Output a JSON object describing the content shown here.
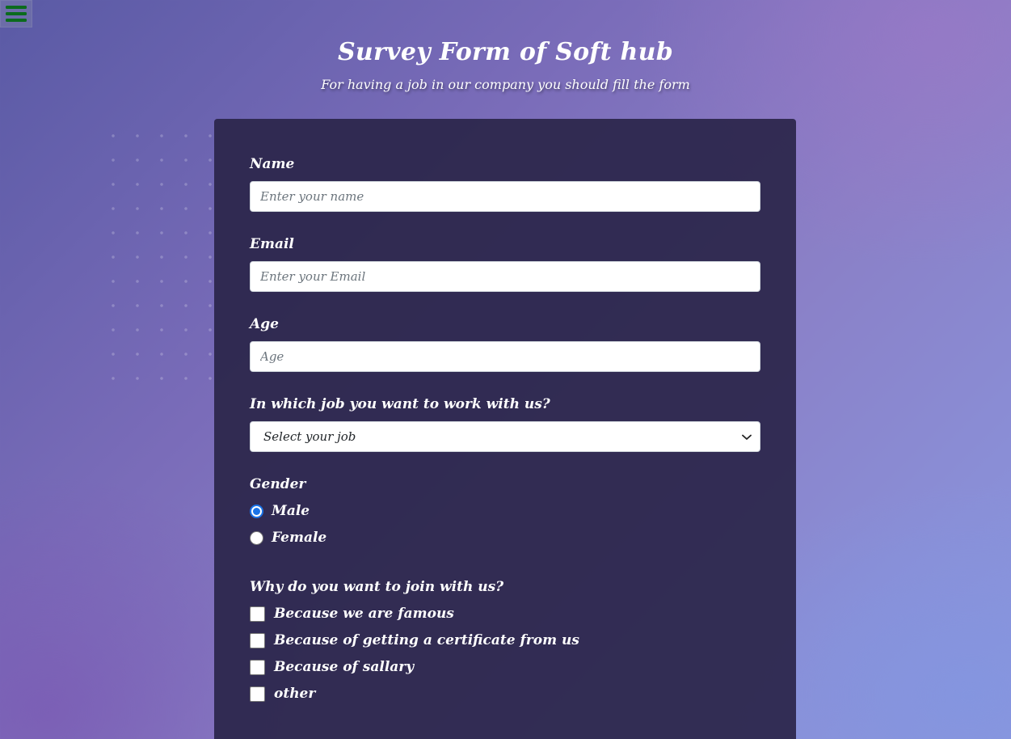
{
  "menu": {
    "icon": "hamburger-menu-icon",
    "icon_color": "#0b6b1d"
  },
  "header": {
    "title": "Survey Form of Soft hub",
    "subtitle": "For having a job in our company you should fill the form"
  },
  "form": {
    "name": {
      "label": "Name",
      "placeholder": "Enter your name",
      "value": ""
    },
    "email": {
      "label": "Email",
      "placeholder": "Enter your Email",
      "value": ""
    },
    "age": {
      "label": "Age",
      "placeholder": "Age",
      "value": ""
    },
    "job": {
      "label": "In which job you want to work with us?",
      "selected": "Select your job"
    },
    "gender": {
      "label": "Gender",
      "options": [
        {
          "label": "Male",
          "checked": true
        },
        {
          "label": "Female",
          "checked": false
        }
      ]
    },
    "reasons": {
      "label": "Why do you want to join with us?",
      "options": [
        {
          "label": "Because we are famous",
          "checked": false
        },
        {
          "label": "Because of getting a certificate from us",
          "checked": false
        },
        {
          "label": "Because of sallary",
          "checked": false
        },
        {
          "label": "other",
          "checked": false
        }
      ]
    }
  },
  "colors": {
    "radio_accent": "#1a73e8",
    "card_background": "#2b264a"
  }
}
